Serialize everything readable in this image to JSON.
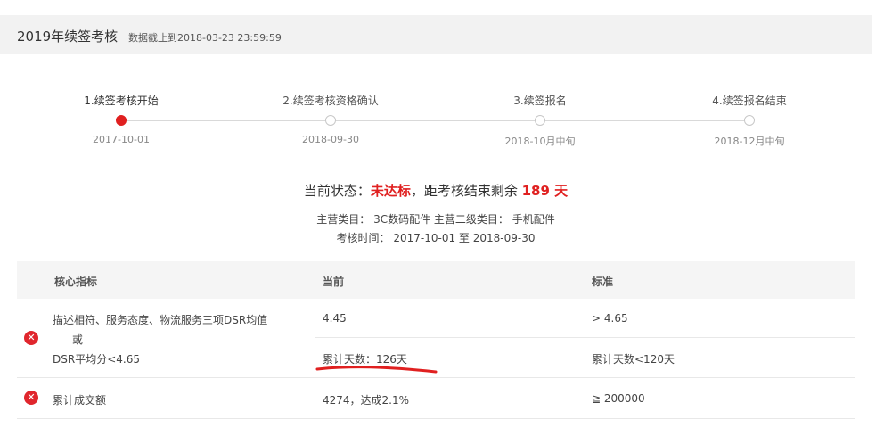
{
  "header": {
    "title": "2019年续签考核",
    "subtitle": "数据截止到2018-03-23 23:59:59"
  },
  "steps": [
    {
      "label": "1.续签考核开始",
      "date": "2017-10-01",
      "active": true
    },
    {
      "label": "2.续签考核资格确认",
      "date": "2018-09-30",
      "active": false
    },
    {
      "label": "3.续签报名",
      "date": "2018-10月中旬",
      "active": false
    },
    {
      "label": "4.续签报名结束",
      "date": "2018-12月中旬",
      "active": false
    }
  ],
  "status": {
    "prefix": "当前状态：",
    "value": "未达标",
    "middle": "，距考核结束剩余 ",
    "days": "189 天"
  },
  "category": {
    "label": "主营类目：",
    "main": "3C数码配件",
    "sub_label": "主营二级类目：",
    "sub": "手机配件"
  },
  "period": {
    "label": "考核时间：",
    "value": "2017-10-01 至 2018-09-30"
  },
  "table": {
    "headers": [
      "核心指标",
      "当前",
      "标准"
    ],
    "rows": [
      {
        "metric_line1": "描述相符、服务态度、物流服务三项DSR均值",
        "metric_line2": "或",
        "metric_line3": "DSR平均分<4.65",
        "current1": "4.45",
        "standard1": "> 4.65",
        "current2": "累计天数：126天",
        "standard2": "累计天数<120天"
      },
      {
        "metric": "累计成交额",
        "current": "4274，达成2.1%",
        "standard": "≧ 200000"
      }
    ]
  },
  "colors": {
    "accent": "#e02020",
    "error_icon": "#e0262d"
  },
  "icons": {
    "row_status": "error-circle-icon"
  }
}
